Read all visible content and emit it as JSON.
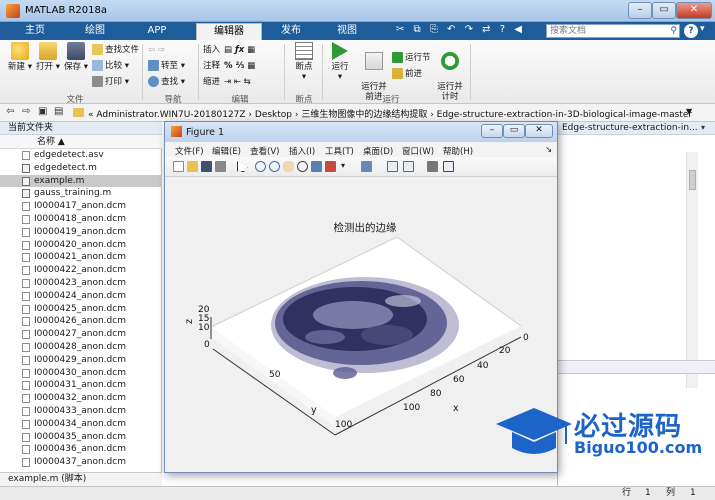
{
  "window": {
    "title": "MATLAB R2018a"
  },
  "tabs": [
    {
      "label": "主页"
    },
    {
      "label": "绘图"
    },
    {
      "label": "APP"
    },
    {
      "label": "编辑器"
    },
    {
      "label": "发布"
    },
    {
      "label": "视图"
    }
  ],
  "quick_access": "✂ ⧉ ⎘ ↶ ↷ ⇄ ? ◀",
  "search": {
    "placeholder": "搜索文档"
  },
  "ribbon": {
    "new": "新建",
    "open": "打开",
    "save": "保存",
    "find_files": "查找文件",
    "compare": "比较 ▾",
    "print": "打印 ▾",
    "goto": "转至 ▾",
    "find": "查找 ▾",
    "insert": "插入",
    "comment": "注释",
    "indent": "缩进",
    "breakpoints": "断点",
    "run": "运行",
    "run_advance": "运行并\n前进",
    "run_section": "运行节",
    "advance": "前进",
    "run_time": "运行并\n计时",
    "groups": {
      "file": "文件",
      "navigate": "导航",
      "edit": "编辑",
      "breakpoints": "断点",
      "run": "运行"
    }
  },
  "address": {
    "path": "« Administrator.WIN7U-20180127Z  ›  Desktop  ›  三维生物图像中的边缘结构提取  ›  Edge-structure-extraction-in-3D-biological-image-master"
  },
  "current_folder": {
    "title": "当前文件夹",
    "column_name": "名称 ▲",
    "files": [
      "edgedetect.asv",
      "edgedetect.m",
      "example.m",
      "gauss_training.m",
      "I0000417_anon.dcm",
      "I0000418_anon.dcm",
      "I0000419_anon.dcm",
      "I0000420_anon.dcm",
      "I0000421_anon.dcm",
      "I0000422_anon.dcm",
      "I0000423_anon.dcm",
      "I0000424_anon.dcm",
      "I0000425_anon.dcm",
      "I0000426_anon.dcm",
      "I0000427_anon.dcm",
      "I0000428_anon.dcm",
      "I0000429_anon.dcm",
      "I0000430_anon.dcm",
      "I0000431_anon.dcm",
      "I0000432_anon.dcm",
      "I0000433_anon.dcm",
      "I0000434_anon.dcm",
      "I0000435_anon.dcm",
      "I0000436_anon.dcm",
      "I0000437_anon.dcm"
    ],
    "selected_index": 2,
    "status": "example.m  (脚本)"
  },
  "right_panel": {
    "header": "Edge-structure-extraction-in..."
  },
  "statusbar": {
    "row_label": "行",
    "row_value": "1",
    "col_label": "列",
    "col_value": "1"
  },
  "figure": {
    "title": "Figure 1",
    "menu": [
      "文件(F)",
      "编辑(E)",
      "查看(V)",
      "插入(I)",
      "工具(T)",
      "桌面(D)",
      "窗口(W)",
      "帮助(H)"
    ],
    "plot_title": "检测出的边缘",
    "z_label": "z",
    "y_label": "y",
    "x_label": "x",
    "z_ticks": [
      "20",
      "15",
      "10"
    ],
    "z_zero": "0",
    "y_ticks": [
      "50",
      "100"
    ],
    "x_ticks": [
      "0",
      "20",
      "40",
      "60",
      "80",
      "100"
    ],
    "surface_colors": {
      "dark": "#2e2d5e",
      "mid": "#5b5a8f",
      "light": "#b8b6cf"
    }
  },
  "watermark": {
    "title": "必过源码",
    "site": "Biguo100.com"
  }
}
